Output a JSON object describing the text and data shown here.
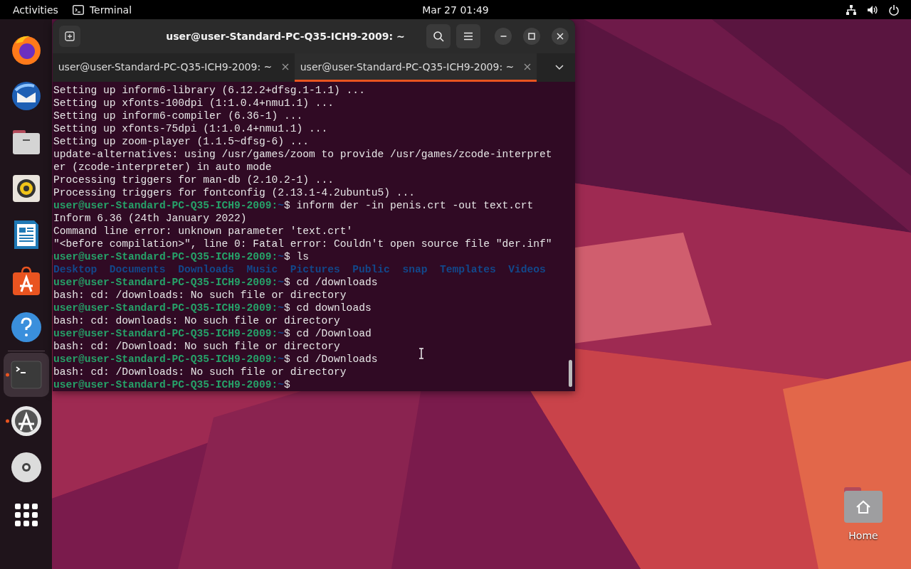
{
  "top_bar": {
    "activities": "Activities",
    "app_name": "Terminal",
    "clock": "Mar 27  01:49"
  },
  "dock": {
    "apps": [
      {
        "running": false,
        "focused": false
      },
      {
        "running": false,
        "focused": false
      },
      {
        "running": false,
        "focused": false
      },
      {
        "running": false,
        "focused": false
      },
      {
        "running": false,
        "focused": false
      },
      {
        "running": false,
        "focused": false
      },
      {
        "running": false,
        "focused": false
      },
      {
        "running": true,
        "focused": true
      },
      {
        "running": true,
        "focused": false
      },
      {
        "running": false,
        "focused": false
      }
    ]
  },
  "window": {
    "title": "user@user-Standard-PC-Q35-ICH9-2009: ~",
    "tabs": [
      {
        "label": "user@user-Standard-PC-Q35-ICH9-2009: ~",
        "selected": false
      },
      {
        "label": "user@user-Standard-PC-Q35-ICH9-2009: ~",
        "selected": true
      }
    ],
    "lines": [
      {
        "kind": "output",
        "text": "Setting up inform6-library (6.12.2+dfsg.1-1.1) ..."
      },
      {
        "kind": "output",
        "text": "Setting up xfonts-100dpi (1:1.0.4+nmu1.1) ..."
      },
      {
        "kind": "output",
        "text": "Setting up inform6-compiler (6.36-1) ..."
      },
      {
        "kind": "output",
        "text": "Setting up xfonts-75dpi (1:1.0.4+nmu1.1) ..."
      },
      {
        "kind": "output",
        "text": "Setting up zoom-player (1.1.5~dfsg-6) ..."
      },
      {
        "kind": "output",
        "text": "update-alternatives: using /usr/games/zoom to provide /usr/games/zcode-interpret"
      },
      {
        "kind": "output",
        "text": "er (zcode-interpreter) in auto mode"
      },
      {
        "kind": "output",
        "text": "Processing triggers for man-db (2.10.2-1) ..."
      },
      {
        "kind": "output",
        "text": "Processing triggers for fontconfig (2.13.1-4.2ubuntu5) ..."
      },
      {
        "kind": "prompt",
        "host": "user@user-Standard-PC-Q35-ICH9-2009:",
        "cwd": "~",
        "command": "$ inform der -in penis.crt -out text.crt"
      },
      {
        "kind": "output",
        "text": "Inform 6.36 (24th January 2022)"
      },
      {
        "kind": "output",
        "text": "Command line error: unknown parameter 'text.crt'"
      },
      {
        "kind": "output",
        "text": "\"<before compilation>\", line 0: Fatal error: Couldn't open source file \"der.inf\""
      },
      {
        "kind": "prompt",
        "host": "user@user-Standard-PC-Q35-ICH9-2009:",
        "cwd": "~",
        "command": "$ ls"
      },
      {
        "kind": "listing",
        "items": [
          "Desktop",
          "Documents",
          "Downloads",
          "Music",
          "Pictures",
          "Public",
          "snap",
          "Templates",
          "Videos"
        ]
      },
      {
        "kind": "prompt",
        "host": "user@user-Standard-PC-Q35-ICH9-2009:",
        "cwd": "~",
        "command": "$ cd /downloads"
      },
      {
        "kind": "output",
        "text": "bash: cd: /downloads: No such file or directory"
      },
      {
        "kind": "prompt",
        "host": "user@user-Standard-PC-Q35-ICH9-2009:",
        "cwd": "~",
        "command": "$ cd downloads"
      },
      {
        "kind": "output",
        "text": "bash: cd: downloads: No such file or directory"
      },
      {
        "kind": "prompt",
        "host": "user@user-Standard-PC-Q35-ICH9-2009:",
        "cwd": "~",
        "command": "$ cd /Download"
      },
      {
        "kind": "output",
        "text": "bash: cd: /Download: No such file or directory"
      },
      {
        "kind": "prompt",
        "host": "user@user-Standard-PC-Q35-ICH9-2009:",
        "cwd": "~",
        "command": "$ cd /Downloads"
      },
      {
        "kind": "output",
        "text": "bash: cd: /Downloads: No such file or directory"
      },
      {
        "kind": "prompt",
        "host": "user@user-Standard-PC-Q35-ICH9-2009:",
        "cwd": "~",
        "command": "$"
      }
    ]
  },
  "desktop": {
    "icons": [
      {
        "label": "Home"
      }
    ]
  }
}
